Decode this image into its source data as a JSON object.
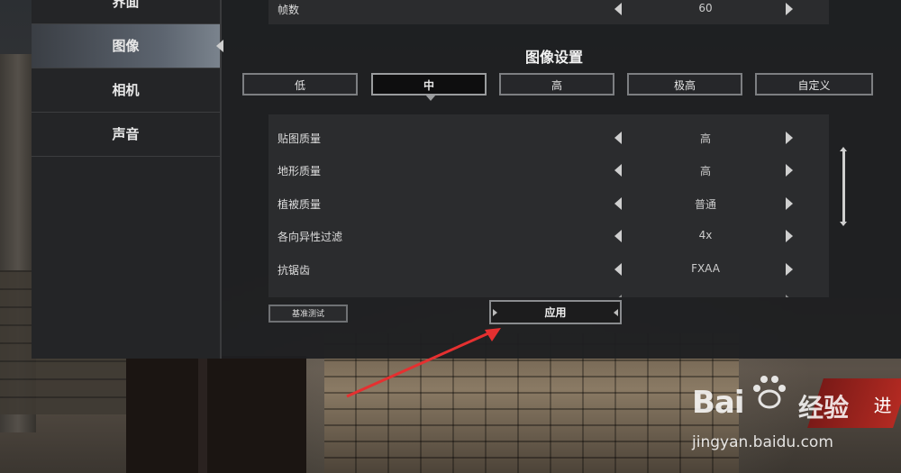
{
  "sidebar": {
    "items": [
      {
        "label": "界面"
      },
      {
        "label": "图像"
      },
      {
        "label": "相机"
      },
      {
        "label": "声音"
      }
    ]
  },
  "top_row": {
    "label": "帧数",
    "value": "60"
  },
  "section_title": "图像设置",
  "presets": [
    "低",
    "中",
    "高",
    "极高",
    "自定义"
  ],
  "settings": [
    {
      "label": "贴图质量",
      "value": "高"
    },
    {
      "label": "地形质量",
      "value": "高"
    },
    {
      "label": "植被质量",
      "value": "普通"
    },
    {
      "label": "各向异性过滤",
      "value": "4x"
    },
    {
      "label": "抗锯齿",
      "value": "FXAA"
    }
  ],
  "buttons": {
    "benchmark": "基准测试",
    "apply": "应用"
  },
  "banner_text": "进",
  "watermark": {
    "brand": "Bai",
    "brand_cn": "经验",
    "url": "jingyan.baidu.com"
  },
  "colors": {
    "panel": "#1e1f21",
    "accent_red": "#e03030"
  },
  "icons": {
    "left": "chevron-left-icon",
    "right": "chevron-right-icon"
  }
}
